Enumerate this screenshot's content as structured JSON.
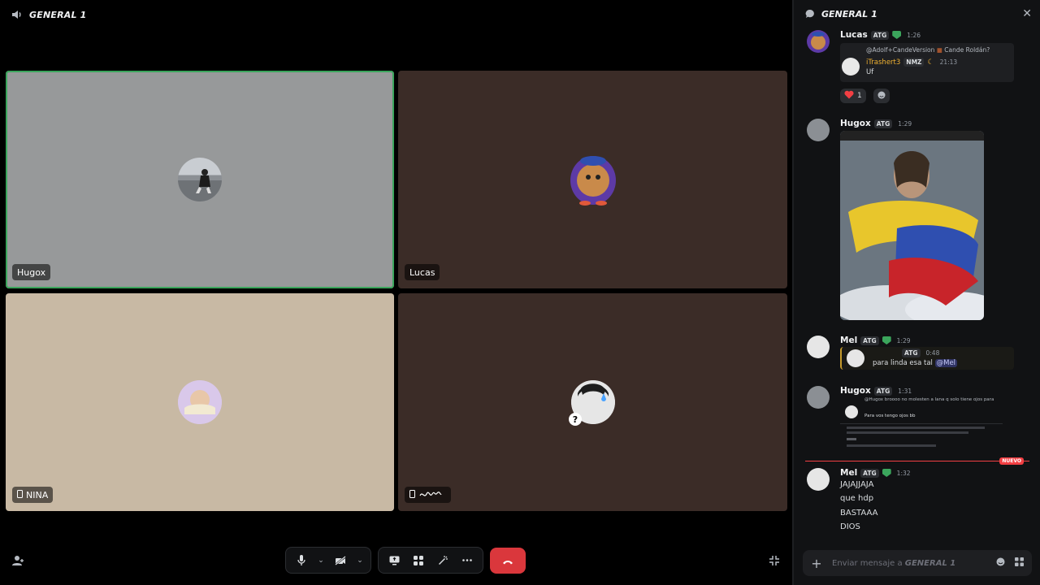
{
  "stage": {
    "channel_title": "GENERAL 1",
    "tiles": [
      {
        "name": "Hugox",
        "phone": false,
        "bg": "#97999a",
        "speaking": true
      },
      {
        "name": "Lucas",
        "phone": false,
        "bg": "#3b2c27",
        "speaking": false
      },
      {
        "name": "NINA",
        "phone": true,
        "bg": "#c8b9a4",
        "speaking": false
      },
      {
        "name": "",
        "phone": true,
        "bg": "#3b2c27",
        "speaking": false
      }
    ],
    "colors": {
      "speaking_ring": "#3ba55c",
      "hangup": "#da373c"
    }
  },
  "chat": {
    "title": "GENERAL 1",
    "composer_placeholder": "Enviar mensaje a",
    "composer_channel": "GENERAL 1",
    "new_label": "NUEVO",
    "messages": [
      {
        "author": "Lucas",
        "tag": "ATG",
        "time": "1:26",
        "reply": {
          "ref_line": "@Adolf+CandeVersion",
          "ref_after": "Cande Roldán?",
          "reply_author": "iTrashert3",
          "reply_tag": "NMZ",
          "reply_time": "21:13",
          "reply_text": "Uf"
        },
        "reactions": [
          {
            "emoji": "heart",
            "count": "1"
          }
        ]
      },
      {
        "author": "Hugox",
        "tag": "ATG",
        "time": "1:29",
        "image_caption": "Jesus embracing the Venezuelan flag"
      },
      {
        "author": "Mel",
        "tag": "ATG",
        "time": "1:29",
        "quote_tag": "ATG",
        "quote_time": "0:48",
        "quote_text": "para linda esa tal",
        "quote_mention": "@Mel"
      },
      {
        "author": "Hugox",
        "tag": "ATG",
        "time": "1:31",
        "quote_line": "@Hugox broooo no molesten a lana q solo tiene ojos para",
        "quote_text": "Para vos tengo ojos bb"
      },
      {
        "author": "Mel",
        "tag": "ATG",
        "time": "1:32",
        "lines": [
          "JAJAJJAJA",
          "que hdp",
          "BASTAAA",
          "DIOS"
        ]
      }
    ]
  }
}
